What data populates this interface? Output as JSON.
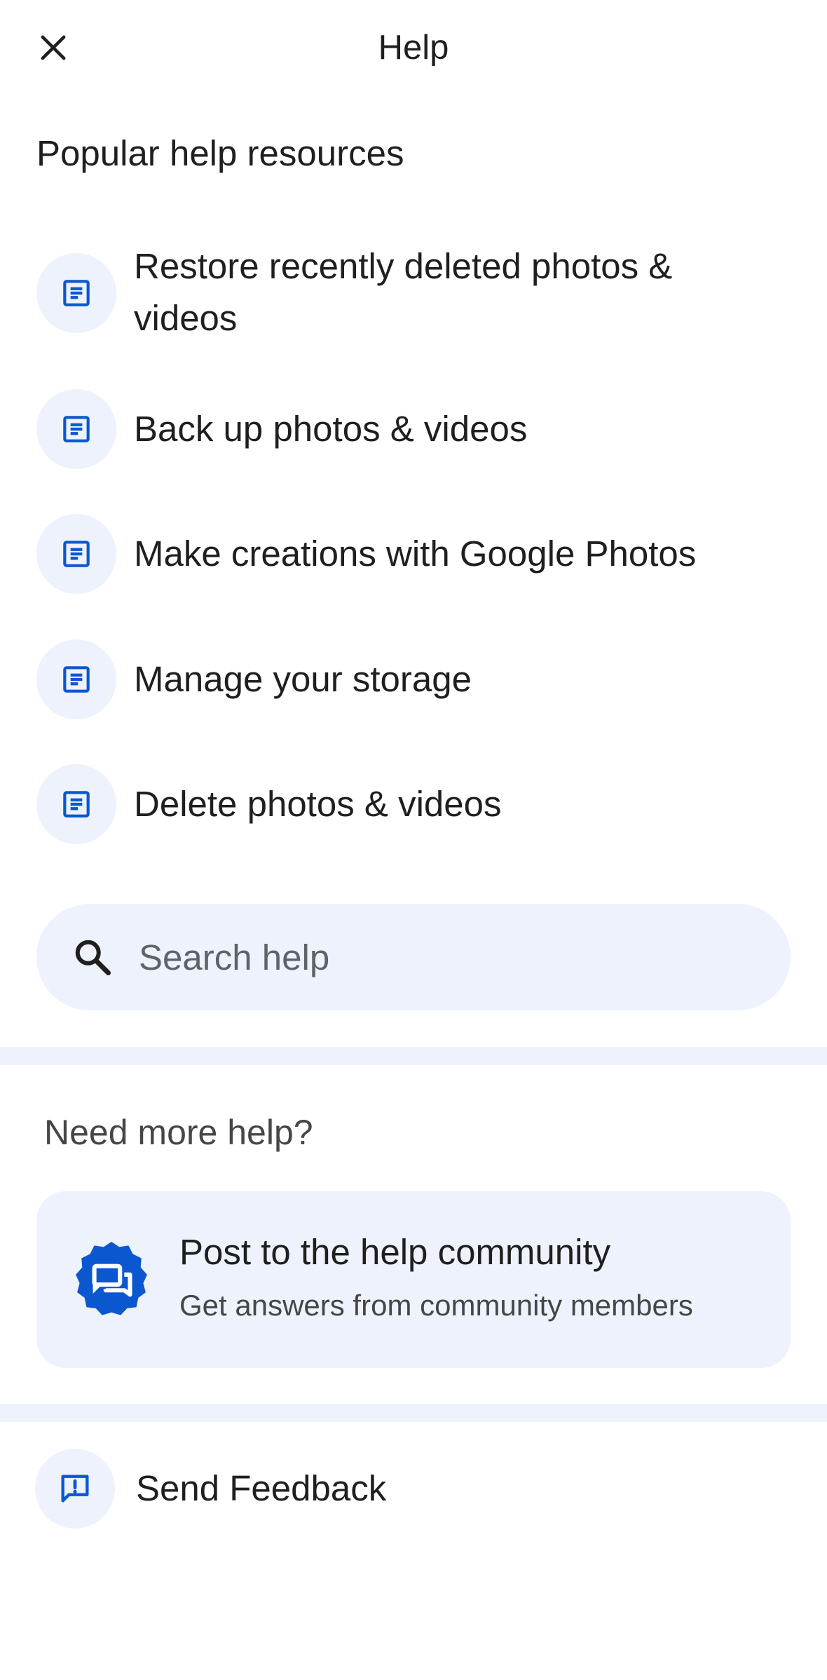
{
  "header": {
    "title": "Help",
    "close_icon": "close-icon"
  },
  "popular": {
    "title": "Popular help resources",
    "items": [
      {
        "label": "Restore recently deleted photos & videos",
        "icon": "article-icon"
      },
      {
        "label": "Back up photos & videos",
        "icon": "article-icon"
      },
      {
        "label": "Make creations with Google Photos",
        "icon": "article-icon"
      },
      {
        "label": "Manage your storage",
        "icon": "article-icon"
      },
      {
        "label": "Delete photos & videos",
        "icon": "article-icon"
      }
    ]
  },
  "search": {
    "placeholder": "Search help",
    "value": "",
    "icon": "search-icon"
  },
  "more_help": {
    "title": "Need more help?",
    "community": {
      "title": "Post to the help community",
      "subtitle": "Get answers from community members",
      "icon": "community-forum-icon"
    }
  },
  "feedback": {
    "label": "Send Feedback",
    "icon": "feedback-icon"
  },
  "colors": {
    "accent": "#0b57d0",
    "chip_bg": "#edf2fc",
    "text_primary": "#1f1f1f",
    "text_secondary": "#444746"
  }
}
